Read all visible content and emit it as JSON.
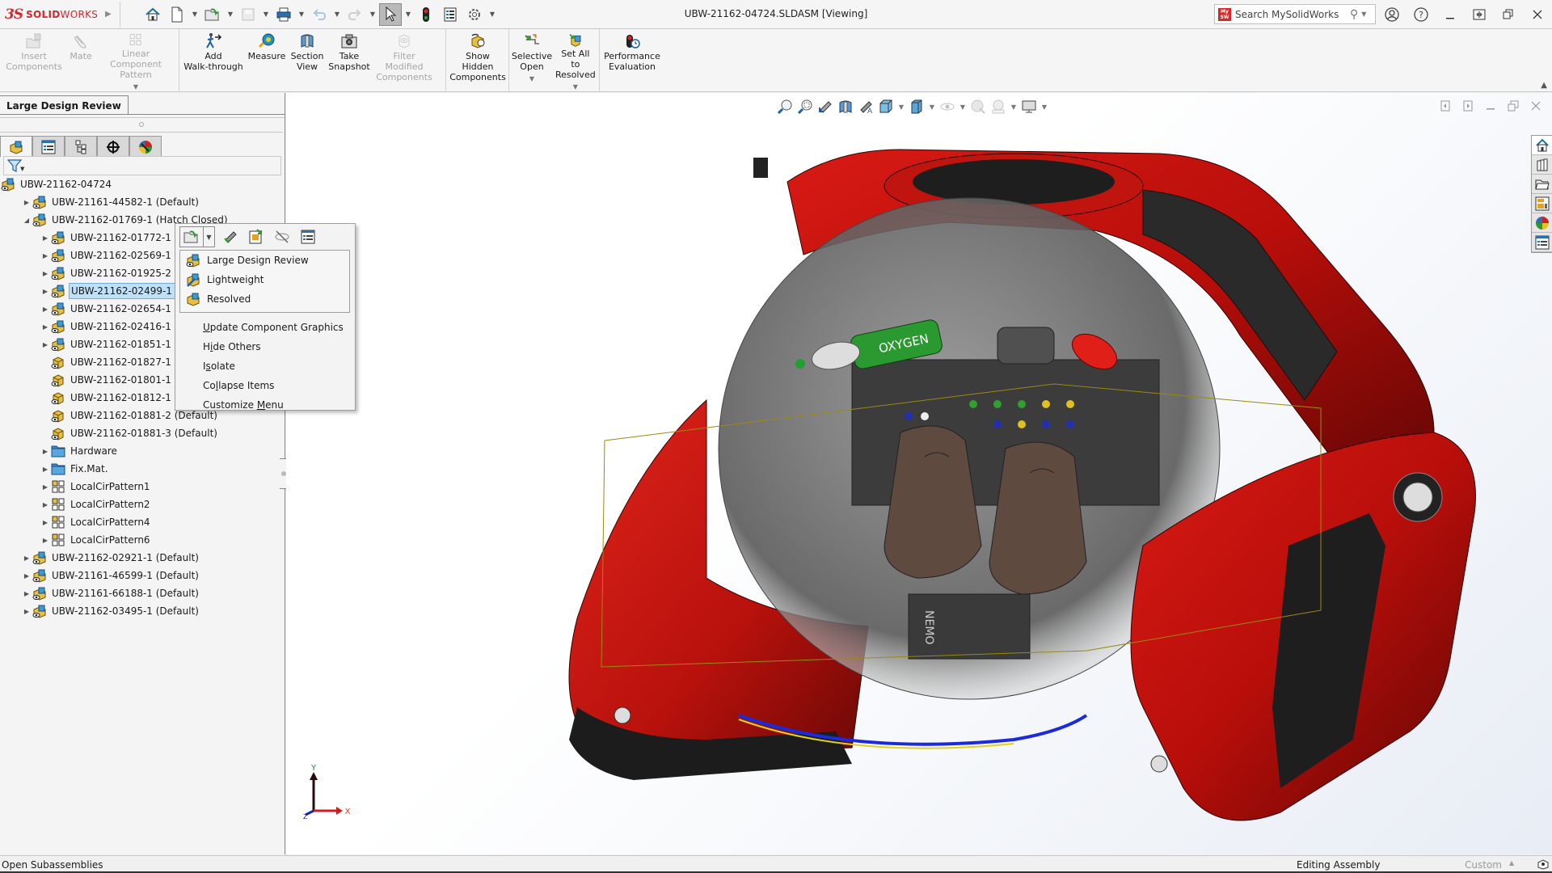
{
  "app": {
    "brand_prefix": "3S",
    "brand_bold": "SOLID",
    "brand_light": "WORKS",
    "document_title": "UBW-21162-04724.SLDASM [Viewing]"
  },
  "quick_access": [
    {
      "name": "home",
      "icon": "home-icon"
    },
    {
      "name": "new-document",
      "icon": "new-document-icon",
      "dropdown": true
    },
    {
      "name": "open",
      "icon": "open-folder-icon",
      "dropdown": true
    },
    {
      "name": "save",
      "icon": "save-icon",
      "dropdown": true,
      "disabled": true
    },
    {
      "name": "print",
      "icon": "print-icon",
      "dropdown": true
    },
    {
      "name": "undo",
      "icon": "undo-icon",
      "dropdown": true,
      "disabled": true
    },
    {
      "name": "redo",
      "icon": "redo-icon",
      "dropdown": true,
      "disabled": true
    },
    {
      "name": "select",
      "icon": "cursor-icon",
      "dropdown": true,
      "active": true
    },
    {
      "name": "rebuild",
      "icon": "traffic-light-icon"
    },
    {
      "name": "file-properties",
      "icon": "list-icon"
    },
    {
      "name": "options",
      "icon": "gear-icon",
      "dropdown": true
    }
  ],
  "search": {
    "badge": "My SW",
    "placeholder": "Search MySolidWorks"
  },
  "window_controls": [
    "user-icon",
    "help-icon",
    "minimize-icon",
    "tile-icon",
    "restore-icon",
    "close-icon"
  ],
  "command_manager": {
    "groups": [
      [
        {
          "label": [
            "Insert",
            "Components"
          ],
          "icon": "insert-components-icon",
          "disabled": true
        },
        {
          "label": [
            "Mate"
          ],
          "icon": "mate-icon",
          "disabled": true
        },
        {
          "label": [
            "Linear Component",
            "Pattern"
          ],
          "icon": "linear-pattern-icon",
          "disabled": true,
          "dropdown": true
        }
      ],
      [
        {
          "label": [
            "Add",
            "Walk-through"
          ],
          "icon": "walk-through-icon"
        },
        {
          "label": [
            "Measure"
          ],
          "icon": "measure-icon"
        },
        {
          "label": [
            "Section",
            "View"
          ],
          "icon": "section-view-icon"
        },
        {
          "label": [
            "Take",
            "Snapshot"
          ],
          "icon": "camera-icon"
        },
        {
          "label": [
            "Filter",
            "Modified",
            "Components"
          ],
          "icon": "filter-modified-icon",
          "disabled": true
        }
      ],
      [
        {
          "label": [
            "Show",
            "Hidden",
            "Components"
          ],
          "icon": "show-hidden-icon"
        }
      ],
      [
        {
          "label": [
            "Selective",
            "Open"
          ],
          "icon": "selective-open-icon",
          "dropdown": true
        },
        {
          "label": [
            "Set All to",
            "Resolved"
          ],
          "icon": "set-resolved-icon",
          "dropdown": true
        }
      ],
      [
        {
          "label": [
            "Performance",
            "Evaluation"
          ],
          "icon": "performance-icon"
        }
      ]
    ]
  },
  "left_panel": {
    "tab_label": "Large Design Review",
    "tabs": [
      "feature-manager-icon",
      "property-manager-icon",
      "configuration-manager-icon",
      "dimxpert-icon",
      "display-manager-icon"
    ],
    "tree": [
      {
        "label": "UBW-21162-04724",
        "level": 0,
        "expander": "",
        "icon": "assembly"
      },
      {
        "label": "UBW-21161-44582-1 (Default)",
        "level": 1,
        "expander": "collapsed",
        "icon": "assembly"
      },
      {
        "label": "UBW-21162-01769-1 (Hatch Closed)",
        "level": 1,
        "expander": "expanded",
        "icon": "assembly"
      },
      {
        "label": "UBW-21162-01772-1 (Default)",
        "level": 2,
        "expander": "collapsed",
        "icon": "assembly"
      },
      {
        "label": "UBW-21162-02569-1 (Default)",
        "level": 2,
        "expander": "collapsed",
        "icon": "assembly"
      },
      {
        "label": "UBW-21162-01925-2 (closed)",
        "level": 2,
        "expander": "collapsed",
        "icon": "assembly"
      },
      {
        "label": "UBW-21162-02499-1 (Default)",
        "level": 2,
        "expander": "collapsed",
        "icon": "assembly",
        "selected": true
      },
      {
        "label": "UBW-21162-02654-1 (Default)",
        "level": 2,
        "expander": "collapsed",
        "icon": "assembly"
      },
      {
        "label": "UBW-21162-02416-1 (Default)",
        "level": 2,
        "expander": "collapsed",
        "icon": "assembly"
      },
      {
        "label": "UBW-21162-01851-1 (Default)",
        "level": 2,
        "expander": "collapsed",
        "icon": "assembly"
      },
      {
        "label": "UBW-21162-01827-1 (Default)",
        "level": 2,
        "expander": "",
        "icon": "part"
      },
      {
        "label": "UBW-21162-01801-1 (Default)",
        "level": 2,
        "expander": "",
        "icon": "part"
      },
      {
        "label": "UBW-21162-01812-1 (Default)",
        "level": 2,
        "expander": "",
        "icon": "part"
      },
      {
        "label": "UBW-21162-01881-2 (Default)",
        "level": 2,
        "expander": "",
        "icon": "part"
      },
      {
        "label": "UBW-21162-01881-3 (Default)",
        "level": 2,
        "expander": "",
        "icon": "part"
      },
      {
        "label": "Hardware",
        "level": 2,
        "expander": "collapsed",
        "icon": "folder"
      },
      {
        "label": "Fix.Mat.",
        "level": 2,
        "expander": "collapsed",
        "icon": "folder"
      },
      {
        "label": "LocalCirPattern1",
        "level": 2,
        "expander": "collapsed",
        "icon": "pattern"
      },
      {
        "label": "LocalCirPattern2",
        "level": 2,
        "expander": "collapsed",
        "icon": "pattern"
      },
      {
        "label": "LocalCirPattern4",
        "level": 2,
        "expander": "collapsed",
        "icon": "pattern"
      },
      {
        "label": "LocalCirPattern6",
        "level": 2,
        "expander": "collapsed",
        "icon": "pattern"
      },
      {
        "label": "UBW-21162-02921-1 (Default)",
        "level": 1,
        "expander": "collapsed",
        "icon": "assembly"
      },
      {
        "label": "UBW-21161-46599-1 (Default)",
        "level": 1,
        "expander": "collapsed",
        "icon": "assembly"
      },
      {
        "label": "UBW-21161-66188-1 (Default)",
        "level": 1,
        "expander": "collapsed",
        "icon": "assembly"
      },
      {
        "label": "UBW-21162-03495-1 (Default)",
        "level": 1,
        "expander": "collapsed",
        "icon": "assembly"
      }
    ]
  },
  "context_menu": {
    "toolbar": [
      "open-subassembly-icon",
      "zoom-to-selection-icon",
      "open-drawing-icon",
      "hide-components-icon",
      "component-properties-icon"
    ],
    "submenu": [
      {
        "label": "Large Design Review",
        "icon": "large-design-review-icon"
      },
      {
        "label": "Lightweight",
        "icon": "lightweight-icon"
      },
      {
        "label": "Resolved",
        "icon": "resolved-icon"
      }
    ],
    "items": [
      {
        "label": "Update Component Graphics",
        "mnemonic": "U"
      },
      {
        "label": "Hide Others",
        "mnemonic": "i"
      },
      {
        "label": "Isolate",
        "mnemonic": "s"
      },
      {
        "label": "Collapse Items",
        "mnemonic": "l"
      },
      {
        "label": "Customize Menu",
        "mnemonic": "M"
      }
    ]
  },
  "heads_up_toolbar": [
    {
      "icon": "zoom-to-fit-icon"
    },
    {
      "icon": "zoom-to-area-icon"
    },
    {
      "icon": "previous-view-icon"
    },
    {
      "icon": "section-view-icon"
    },
    {
      "icon": "walk-through-icon"
    },
    {
      "icon": "view-orientation-icon",
      "dropdown": true
    },
    {
      "icon": "display-style-icon",
      "dropdown": true
    },
    {
      "icon": "hide-show-items-icon",
      "dropdown": true,
      "dim": true
    },
    {
      "icon": "edit-appearance-icon",
      "dim": true
    },
    {
      "icon": "apply-scene-icon",
      "dropdown": true,
      "dim": true
    },
    {
      "icon": "view-settings-icon",
      "dropdown": true
    }
  ],
  "task_pane": [
    "home-icon",
    "design-library-icon",
    "file-explorer-icon",
    "view-palette-icon",
    "appearances-icon",
    "custom-properties-icon"
  ],
  "triad": {
    "x": "X",
    "y": "Y",
    "z": "Z"
  },
  "model_labels": {
    "oxygen": "OXYGEN",
    "nemo": "NEMO"
  },
  "colors": {
    "hull_red": "#c8120e",
    "hull_dark": "#7a0a08",
    "selection": "#bfe0f7",
    "brand": "#d9262a"
  },
  "status_bar": {
    "message": "Open Subassemblies",
    "mode": "Editing Assembly",
    "units": "Custom"
  }
}
